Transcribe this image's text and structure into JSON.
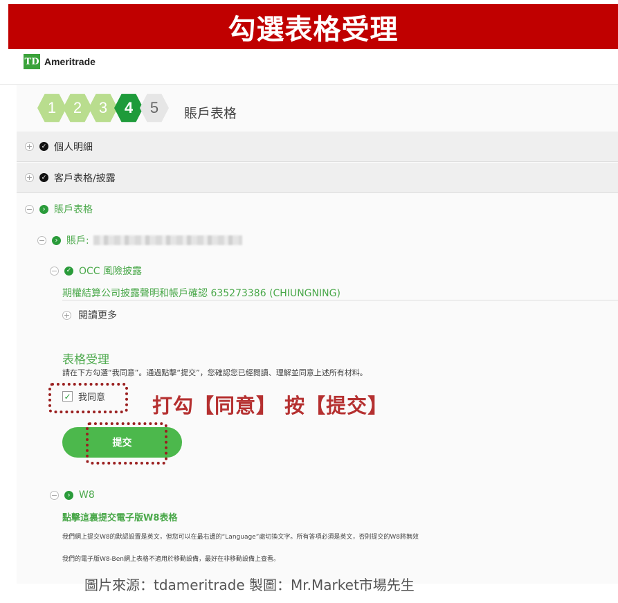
{
  "banner": {
    "title": "勾選表格受理"
  },
  "brand": {
    "logo_mark": "TD",
    "name": "Ameritrade"
  },
  "steps": {
    "items": [
      "1",
      "2",
      "3",
      "4",
      "5"
    ],
    "current": 4,
    "title": "賬戶表格"
  },
  "sections": {
    "personal": {
      "label": "個人明細"
    },
    "customer": {
      "label": "客戶表格/披露"
    },
    "account_forms": {
      "label": "賬戶表格"
    },
    "account": {
      "label": "賬戶:"
    },
    "occ": {
      "label": "OCC 風險披露",
      "doc": "期權結算公司披露聲明和帳戶確認 635273386 (CHIUNGNING)",
      "read_more": "閱讀更多"
    },
    "form_accept": {
      "title": "表格受理",
      "description": "請在下方勾選“我同意”。通過點擊“提交”，您確認您已經閱讀、理解並同意上述所有材料。",
      "agree_label": "我同意",
      "agree_checked": true,
      "submit_label": "提交"
    },
    "w8": {
      "label": "W8",
      "link": "點擊這裏提交電子版W8表格",
      "note1": "我們網上提交W8的默認設置是英文，但您可以在最右邊的“Language”處切換文字。所有答項必須是英文，否則提交的W8將無效",
      "note2": "我們的電子版W8-Ben網上表格不適用於移動設備，最好在非移動設備上查看。"
    }
  },
  "annotation": {
    "text": "打勾【同意】 按【提交】"
  },
  "credit": "圖片來源：tdameritrade  製圖：Mr.Market市場先生",
  "colors": {
    "banner": "#c00000",
    "brand_green": "#4aa84a",
    "step_done": "#b9dd8e",
    "step_current": "#1e9b3a",
    "submit": "#4cb84c",
    "annotation": "#b53030"
  },
  "icons": {
    "expand": "plus-circle-icon",
    "collapse": "minus-circle-icon",
    "complete": "check-circle-icon",
    "in_progress": "arrow-right-circle-icon"
  }
}
